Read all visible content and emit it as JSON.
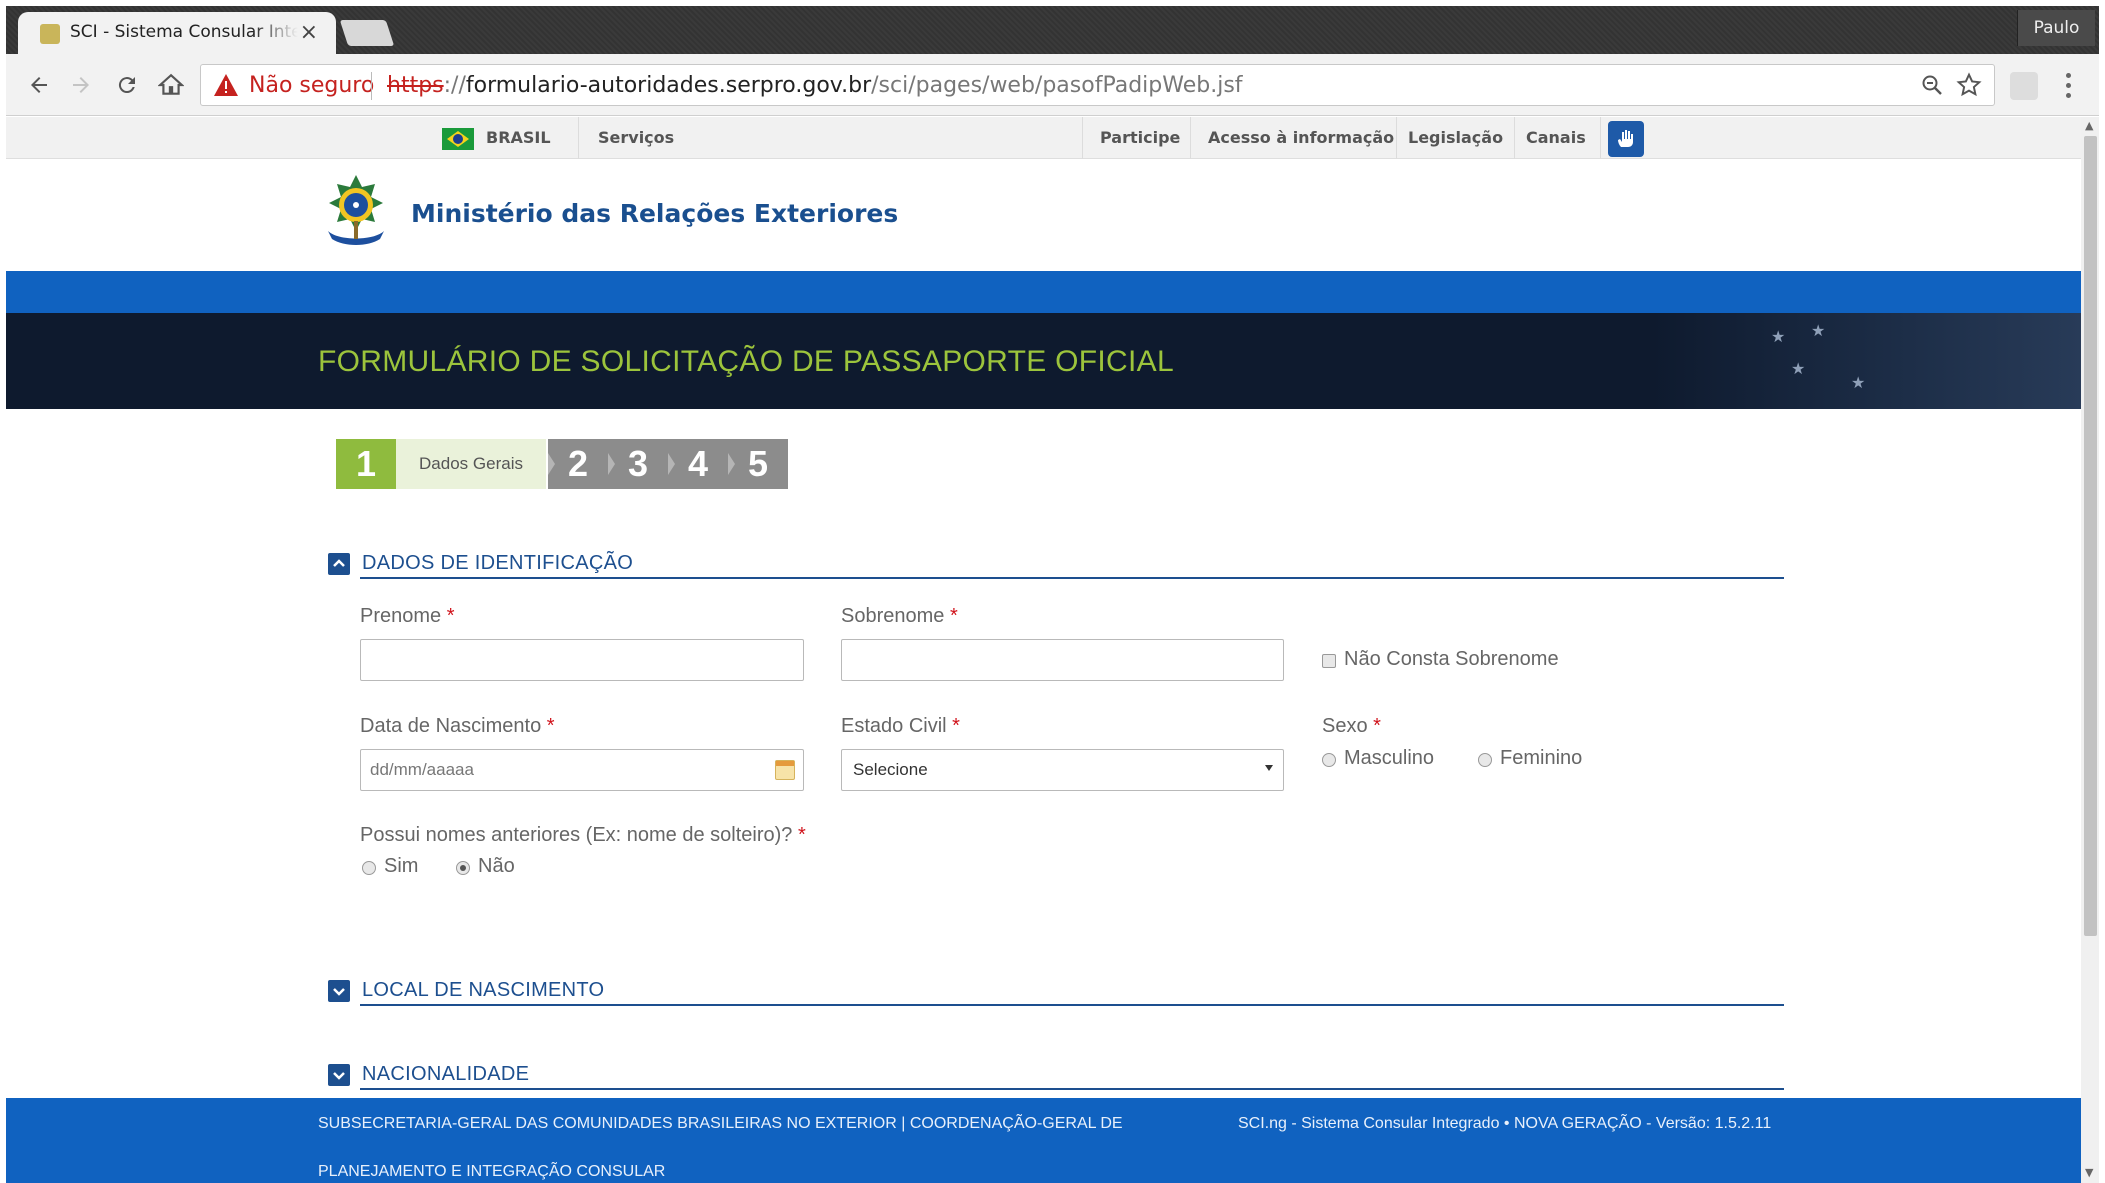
{
  "browser": {
    "tab_title": "SCI - Sistema Consular Integrado",
    "profile_name": "Paulo",
    "security_label": "Não seguro",
    "url_protocol": "https",
    "url_sep": "://",
    "url_host": "formulario-autoridades.serpro.gov.br",
    "url_path": "/sci/pages/web/pasofPadipWeb.jsf"
  },
  "gov_bar": {
    "brasil": "BRASIL",
    "servicos": "Serviços",
    "participe": "Participe",
    "acesso": "Acesso à informação",
    "legislacao": "Legislação",
    "canais": "Canais"
  },
  "header": {
    "ministry": "Ministério das Relações Exteriores",
    "form_title": "FORMULÁRIO DE SOLICITAÇÃO DE PASSAPORTE OFICIAL"
  },
  "wizard": {
    "active_step": "1",
    "active_label": "Dados Gerais",
    "steps": [
      "2",
      "3",
      "4",
      "5"
    ]
  },
  "section_identificacao": {
    "title": "DADOS DE IDENTIFICAÇÃO",
    "prenome_label": "Prenome",
    "sobrenome_label": "Sobrenome",
    "nao_consta_label": "Não Consta Sobrenome",
    "nascimento_label": "Data de Nascimento",
    "nascimento_placeholder": "dd/mm/aaaaa",
    "estado_civil_label": "Estado Civil",
    "estado_civil_value": "Selecione",
    "sexo_label": "Sexo",
    "sexo_options": [
      "Masculino",
      "Feminino"
    ],
    "anteriores_label": "Possui nomes anteriores (Ex: nome de solteiro)?",
    "anteriores_options": [
      "Sim",
      "Não"
    ],
    "anteriores_selected": "Não",
    "required_mark": "*"
  },
  "section_local": {
    "title": "LOCAL DE NASCIMENTO"
  },
  "section_nacionalidade": {
    "title": "NACIONALIDADE"
  },
  "footer": {
    "line1": "SUBSECRETARIA-GERAL DAS COMUNIDADES BRASILEIRAS NO EXTERIOR | COORDENAÇÃO-GERAL DE",
    "line2": "PLANEJAMENTO E INTEGRAÇÃO CONSULAR",
    "version": "SCI.ng - Sistema Consular Integrado • NOVA GERAÇÃO - Versão: 1.5.2.11"
  },
  "colors": {
    "gov_blue": "#1062c0",
    "title_green": "#9cc43c",
    "section_blue": "#1d4f8f",
    "required_red": "#d0121a",
    "insecure_red": "#c5221f"
  }
}
